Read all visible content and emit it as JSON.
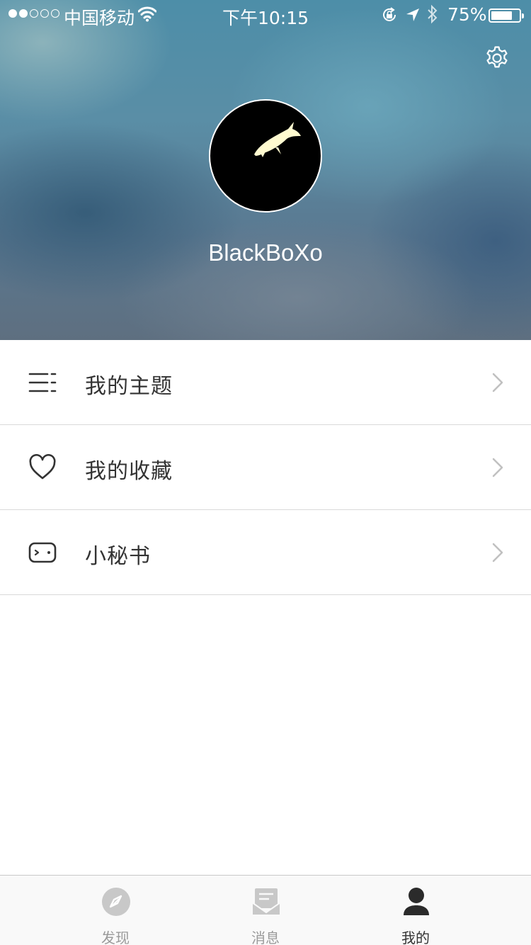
{
  "status_bar": {
    "carrier": "中国移动",
    "time": "下午10:15",
    "battery": "75%",
    "battery_level": 0.75,
    "signal_bars_filled": 2,
    "signal_bars_total": 5
  },
  "profile": {
    "username": "BlackBoXo",
    "settings_icon": "gear-icon",
    "avatar_icon": "fish-icon"
  },
  "menu": {
    "items": [
      {
        "label": "我的主题",
        "icon": "list-icon"
      },
      {
        "label": "我的收藏",
        "icon": "heart-icon"
      },
      {
        "label": "小秘书",
        "icon": "robot-icon"
      }
    ]
  },
  "tabbar": {
    "tabs": [
      {
        "label": "发现",
        "icon": "compass-icon",
        "active": false
      },
      {
        "label": "消息",
        "icon": "message-icon",
        "active": false
      },
      {
        "label": "我的",
        "icon": "user-icon",
        "active": true
      }
    ]
  },
  "colors": {
    "text_primary": "#333333",
    "text_inactive": "#9a9a9a",
    "divider": "#d9d9d9",
    "tabbar_bg": "#f9f9f9"
  }
}
